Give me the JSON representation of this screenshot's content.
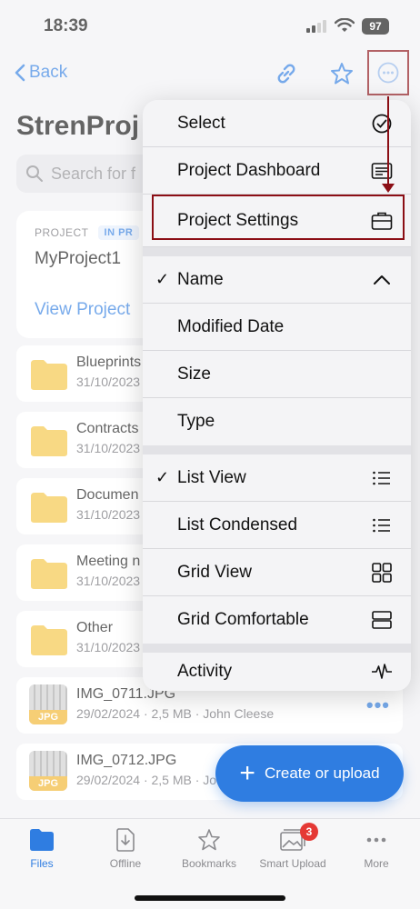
{
  "status_bar": {
    "time": "18:39",
    "battery": "97"
  },
  "nav": {
    "back_label": "Back",
    "link_icon": "link-icon",
    "star_icon": "star-icon",
    "more_icon": "ellipsis-circle-icon"
  },
  "page": {
    "title": "StrenProj",
    "search_placeholder": "Search for f"
  },
  "project_card": {
    "label": "PROJECT",
    "badge": "IN PR",
    "name": "MyProject1",
    "link": "View Project"
  },
  "files": [
    {
      "title": "Blueprints",
      "subtitle": "31/10/2023"
    },
    {
      "title": "Contracts",
      "subtitle": "31/10/2023"
    },
    {
      "title": "Documen",
      "subtitle": "31/10/2023"
    },
    {
      "title": "Meeting n",
      "subtitle": "31/10/2023"
    },
    {
      "title": "Other",
      "subtitle": "31/10/2023"
    },
    {
      "title": "IMG_0711.JPG",
      "subtitle": "29/02/2024 · 2,5 MB · John Cleese",
      "tag": "JPG"
    },
    {
      "title": "IMG_0712.JPG",
      "subtitle": "29/02/2024 · 2,5 MB · Jo",
      "tag": "JPG"
    }
  ],
  "menu": {
    "items": [
      {
        "label": "Select",
        "icon": "checkmark-circle-icon"
      },
      {
        "label": "Project Dashboard",
        "icon": "dashboard-icon"
      },
      {
        "label": "Project Settings",
        "icon": "briefcase-icon"
      },
      {
        "label": "Name",
        "checked": true,
        "icon": "chevron-up-icon"
      },
      {
        "label": "Modified Date"
      },
      {
        "label": "Size"
      },
      {
        "label": "Type"
      },
      {
        "label": "List View",
        "checked": true,
        "icon": "list-icon"
      },
      {
        "label": "List Condensed",
        "icon": "list-condensed-icon"
      },
      {
        "label": "Grid View",
        "icon": "grid-icon"
      },
      {
        "label": "Grid Comfortable",
        "icon": "grid-comfortable-icon"
      },
      {
        "label": "Activity",
        "icon": "activity-icon"
      }
    ],
    "check_glyph": "✓"
  },
  "fab": {
    "label": "Create or upload"
  },
  "tabs": [
    {
      "label": "Files",
      "active": true
    },
    {
      "label": "Offline"
    },
    {
      "label": "Bookmarks"
    },
    {
      "label": "Smart Upload",
      "badge": "3"
    },
    {
      "label": "More"
    }
  ],
  "colors": {
    "accent": "#2f7de1",
    "annotation": "#8b0e15",
    "folder": "#f5c542",
    "badge": "#e53935"
  }
}
